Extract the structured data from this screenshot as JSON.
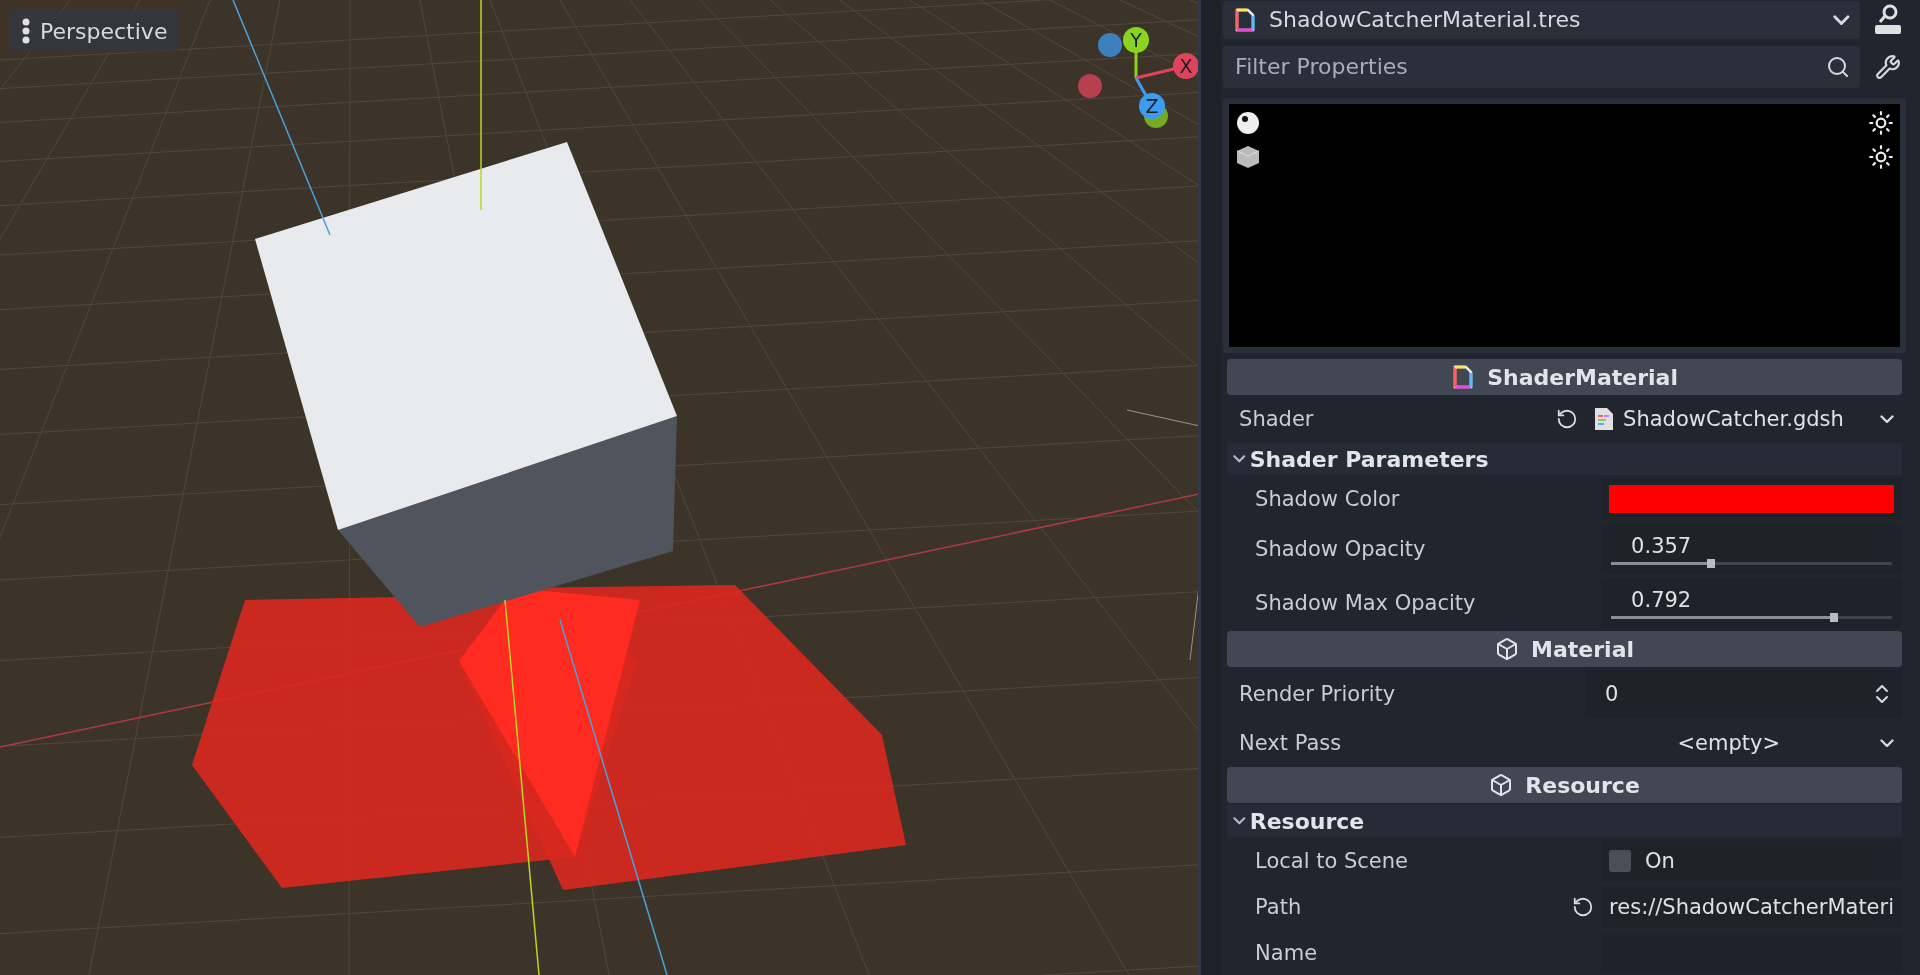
{
  "viewport": {
    "view_menu": {
      "label": "Perspective"
    },
    "gizmo": {
      "axes": [
        {
          "label": "Y",
          "color": "#8ad321"
        },
        {
          "label": "X",
          "color": "#e0445c"
        },
        {
          "label": "Z",
          "color": "#3c9cf0"
        }
      ]
    }
  },
  "inspector": {
    "resource_picker": {
      "value": "ShadowCatcherMaterial.tres"
    },
    "filter": {
      "placeholder": "Filter Properties"
    },
    "rows": [
      {
        "kind": "category",
        "icon": {
          "kind": "resource_file"
        },
        "label": "ShaderMaterial"
      },
      {
        "kind": "resource",
        "label": "Shader",
        "value": "ShadowCatcher.gdsh",
        "revertable": true
      },
      {
        "kind": "group",
        "label": "Shader Parameters",
        "expanded": true,
        "children": [
          {
            "kind": "color",
            "label": "Shadow Color",
            "color": "#ff0000"
          },
          {
            "kind": "slider",
            "label": "Shadow Opacity",
            "value": "0.357",
            "level": 0.357
          },
          {
            "kind": "slider",
            "label": "Shadow Max Opacity",
            "value": "0.792",
            "level": 0.792
          }
        ]
      },
      {
        "kind": "category",
        "icon": {
          "kind": "cube"
        },
        "label": "Material"
      },
      {
        "kind": "spin",
        "label": "Render Priority",
        "value": "0"
      },
      {
        "kind": "dropdown",
        "label": "Next Pass",
        "value": "<empty>"
      },
      {
        "kind": "category",
        "icon": {
          "kind": "cube"
        },
        "label": "Resource"
      },
      {
        "kind": "group",
        "label": "Resource",
        "expanded": true,
        "children": [
          {
            "kind": "checkbox",
            "label": "Local to Scene",
            "value": "On",
            "checked": false
          },
          {
            "kind": "text",
            "label": "Path",
            "value": "res://ShadowCatcherMateri",
            "revertable": true
          },
          {
            "kind": "text",
            "label": "Name"
          }
        ]
      }
    ]
  }
}
